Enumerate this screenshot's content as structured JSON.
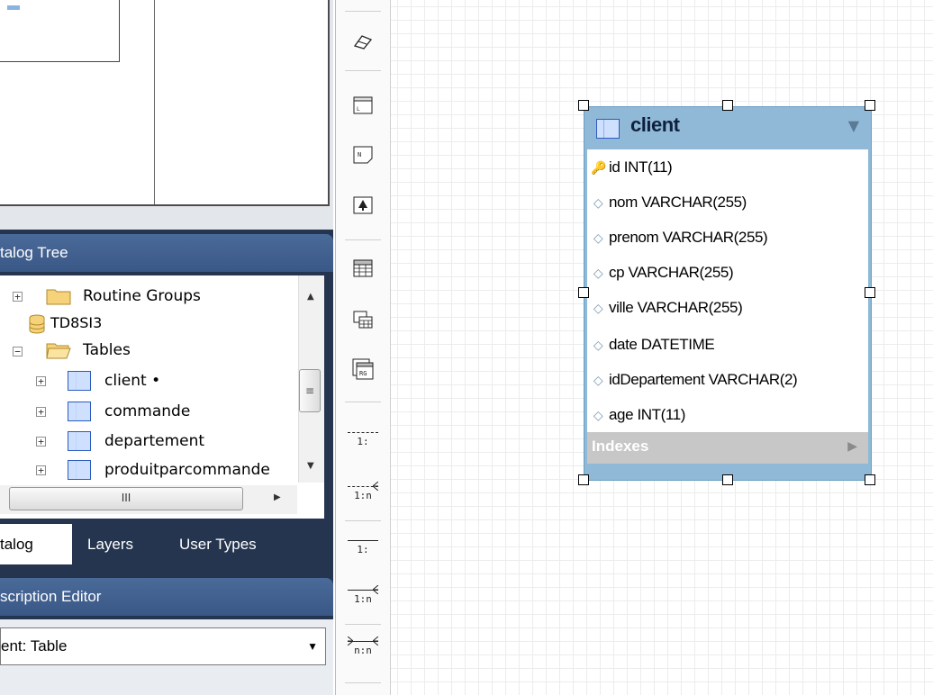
{
  "catalog_panel": {
    "title": "talog Tree"
  },
  "description_panel": {
    "title": "scription Editor",
    "select_value": "ent: Table"
  },
  "tree": {
    "items": [
      {
        "label": "Routine Groups",
        "icon": "folder-icon"
      },
      {
        "label": "TD8SI3",
        "icon": "database-icon"
      },
      {
        "label": "Tables",
        "icon": "folder-open-icon"
      },
      {
        "label": "client •",
        "icon": "table-icon"
      },
      {
        "label": "commande",
        "icon": "table-icon"
      },
      {
        "label": "departement",
        "icon": "table-icon"
      },
      {
        "label": "produitparcommande",
        "icon": "table-icon"
      }
    ],
    "scroll_thumb_glyph": "III"
  },
  "tabs": [
    {
      "label": "talog"
    },
    {
      "label": "Layers"
    },
    {
      "label": "User Types"
    }
  ],
  "toolbar": {
    "tools": [
      "eraser-icon",
      "layer-icon",
      "note-icon",
      "image-icon",
      "table-icon",
      "view-icon",
      "routine-group-icon"
    ],
    "relationships": [
      {
        "label": "1:",
        "style": "dashed",
        "icon": "non-identifying-1-1-icon"
      },
      {
        "label": "1:n",
        "style": "dashed",
        "icon": "non-identifying-1-n-icon"
      },
      {
        "label": "1:",
        "style": "solid",
        "icon": "identifying-1-1-icon"
      },
      {
        "label": "1:n",
        "style": "solid",
        "icon": "identifying-1-n-icon"
      },
      {
        "label": "n:n",
        "style": "solid",
        "icon": "identifying-n-n-icon"
      }
    ]
  },
  "entity": {
    "title": "client",
    "columns": [
      {
        "label": "id INT(11)",
        "icon": "primary-key-icon"
      },
      {
        "label": "nom VARCHAR(255)",
        "icon": "column-diamond-icon"
      },
      {
        "label": "prenom VARCHAR(255)",
        "icon": "column-diamond-icon"
      },
      {
        "label": "cp VARCHAR(255)",
        "icon": "column-diamond-icon"
      },
      {
        "label": "ville VARCHAR(255)",
        "icon": "column-diamond-icon"
      },
      {
        "label": "date DATETIME",
        "icon": "column-diamond-icon"
      },
      {
        "label": "idDepartement VARCHAR(2)",
        "icon": "column-diamond-icon"
      },
      {
        "label": "age INT(11)",
        "icon": "column-diamond-icon"
      }
    ],
    "indexes_label": "Indexes"
  },
  "colors": {
    "panel_dark": "#25354f",
    "panel_header": "#4a6a99",
    "entity_header": "#8fb9d6",
    "primary_key": "#e2b800"
  }
}
